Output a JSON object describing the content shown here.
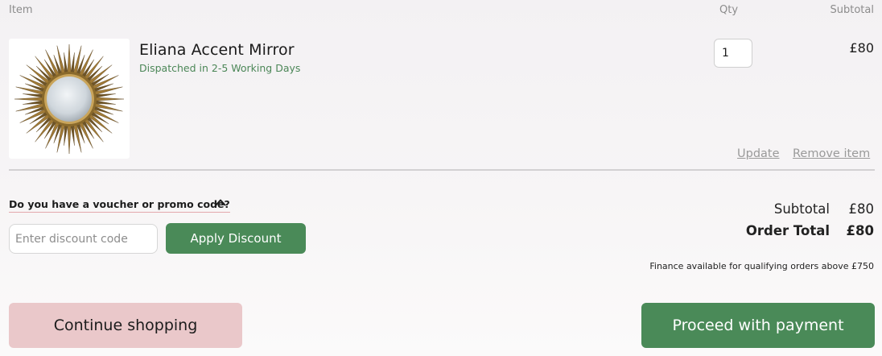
{
  "headers": {
    "item": "Item",
    "qty": "Qty",
    "subtotal": "Subtotal"
  },
  "item": {
    "name": "Eliana Accent Mirror",
    "dispatch": "Dispatched in 2-5 Working Days",
    "quantity": "1",
    "line_subtotal": "£80",
    "image_icon": "sunburst-mirror-image",
    "update_label": "Update",
    "remove_label": "Remove item"
  },
  "voucher": {
    "toggle_label": "Do you have a voucher or promo code?",
    "toggle_icon": "chevron-up-icon",
    "placeholder": "Enter discount code",
    "apply_label": "Apply Discount"
  },
  "totals": {
    "subtotal_label": "Subtotal",
    "subtotal_value": "£80",
    "order_total_label": "Order Total",
    "order_total_value": "£80",
    "finance_note": "Finance available for qualifying orders above £750"
  },
  "actions": {
    "continue_label": "Continue shopping",
    "proceed_label": "Proceed with payment"
  },
  "colors": {
    "primary_green": "#4a8a58",
    "dispatch_green": "#4b8657",
    "continue_pink": "#eac8ca",
    "link_grey": "#9a9a9a",
    "voucher_underline": "#e4a8ad"
  }
}
